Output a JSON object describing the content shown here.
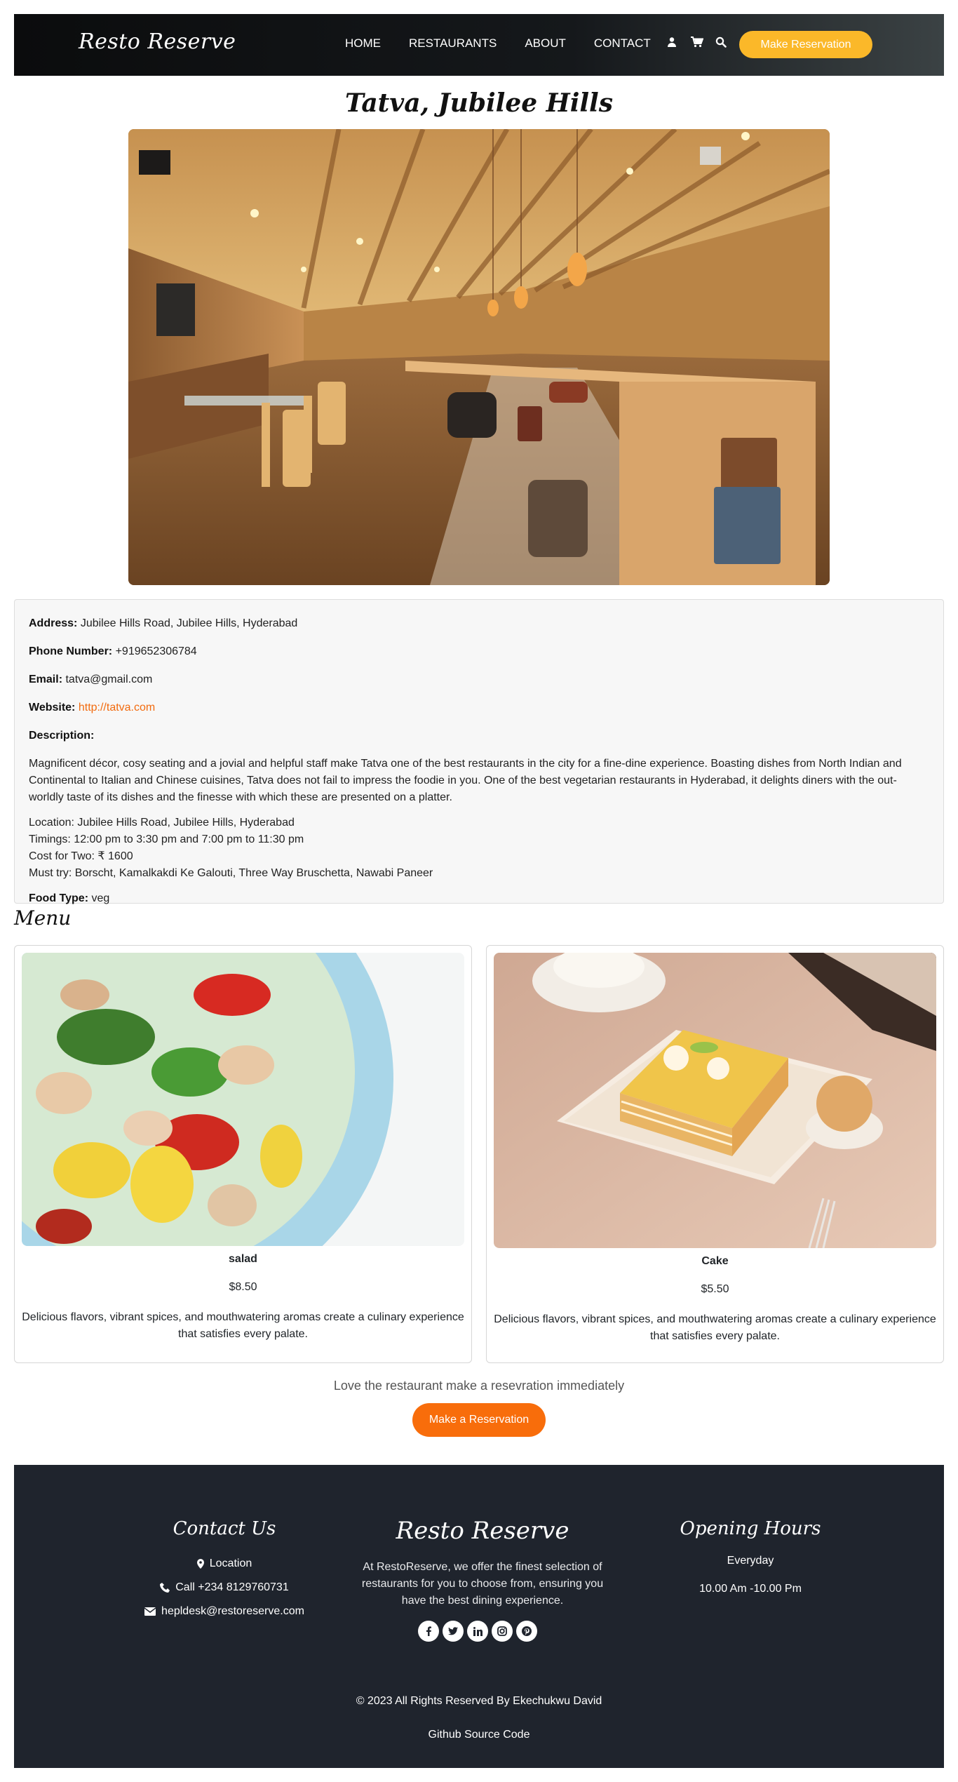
{
  "nav": {
    "brand": "Resto Reserve",
    "links": [
      "HOME",
      "RESTAURANTS",
      "ABOUT",
      "CONTACT"
    ],
    "icons": [
      "user-icon",
      "cart-icon",
      "search-icon"
    ],
    "reserve_label": "Make Reservation",
    "accent": "#fbb829"
  },
  "restaurant": {
    "name": "Tatva, Jubilee Hills",
    "address_label": "Address:",
    "address": "Jubilee Hills Road, Jubilee Hills, Hyderabad",
    "phone_label": "Phone Number:",
    "phone": "+919652306784",
    "email_label": "Email:",
    "email": "tatva@gmail.com",
    "website_label": "Website:",
    "website": "http://tatva.com",
    "description_label": "Description:",
    "description": "Magnificent décor, cosy seating and a jovial and helpful staff make Tatva one of the best restaurants in the city for a fine-dine experience. Boasting dishes from North Indian and Continental to Italian and Chinese cuisines, Tatva does not fail to impress the foodie in you. One of the best vegetarian restaurants in Hyderabad, it delights diners with the out-worldly taste of its dishes and the finesse with which these are presented on a platter.",
    "location_line": "Location: Jubilee Hills Road, Jubilee Hills, Hyderabad",
    "timings_line": "Timings: 12:00 pm to 3:30 pm and 7:00 pm to 11:30 pm",
    "cost_line": "Cost for Two: ₹ 1600",
    "must_try_line": "Must try: Borscht, Kamalkakdi Ke Galouti, Three Way Bruschetta, Nawabi Paneer",
    "food_type_label": "Food Type:",
    "food_type": "veg"
  },
  "menu": {
    "title": "Menu",
    "items": [
      {
        "name": "salad",
        "price": "$8.50",
        "description": "Delicious flavors, vibrant spices, and mouthwatering aromas create a culinary experience that satisfies every palate."
      },
      {
        "name": "Cake",
        "price": "$5.50",
        "description": "Delicious flavors, vibrant spices, and mouthwatering aromas create a culinary experience that satisfies every palate."
      }
    ]
  },
  "cta": {
    "text": "Love the restaurant make a resevration immediately",
    "button": "Make a Reservation",
    "color": "#f86d0b"
  },
  "footer": {
    "contact_title": "Contact Us",
    "location": "Location",
    "call": "Call +234 8129760731",
    "email": "hepldesk@restoreserve.com",
    "brand": "Resto Reserve",
    "about": "At RestoReserve, we offer the finest selection of restaurants for you to choose from, ensuring you have the best dining experience.",
    "socials": [
      "facebook-icon",
      "twitter-icon",
      "linkedin-icon",
      "instagram-icon",
      "pinterest-icon"
    ],
    "hours_title": "Opening Hours",
    "hours_days": "Everyday",
    "hours_time": "10.00 Am -10.00 Pm",
    "copyright": "© 2023 All Rights Reserved By Ekechukwu David",
    "github": "Github Source Code",
    "background": "#1f242d"
  }
}
